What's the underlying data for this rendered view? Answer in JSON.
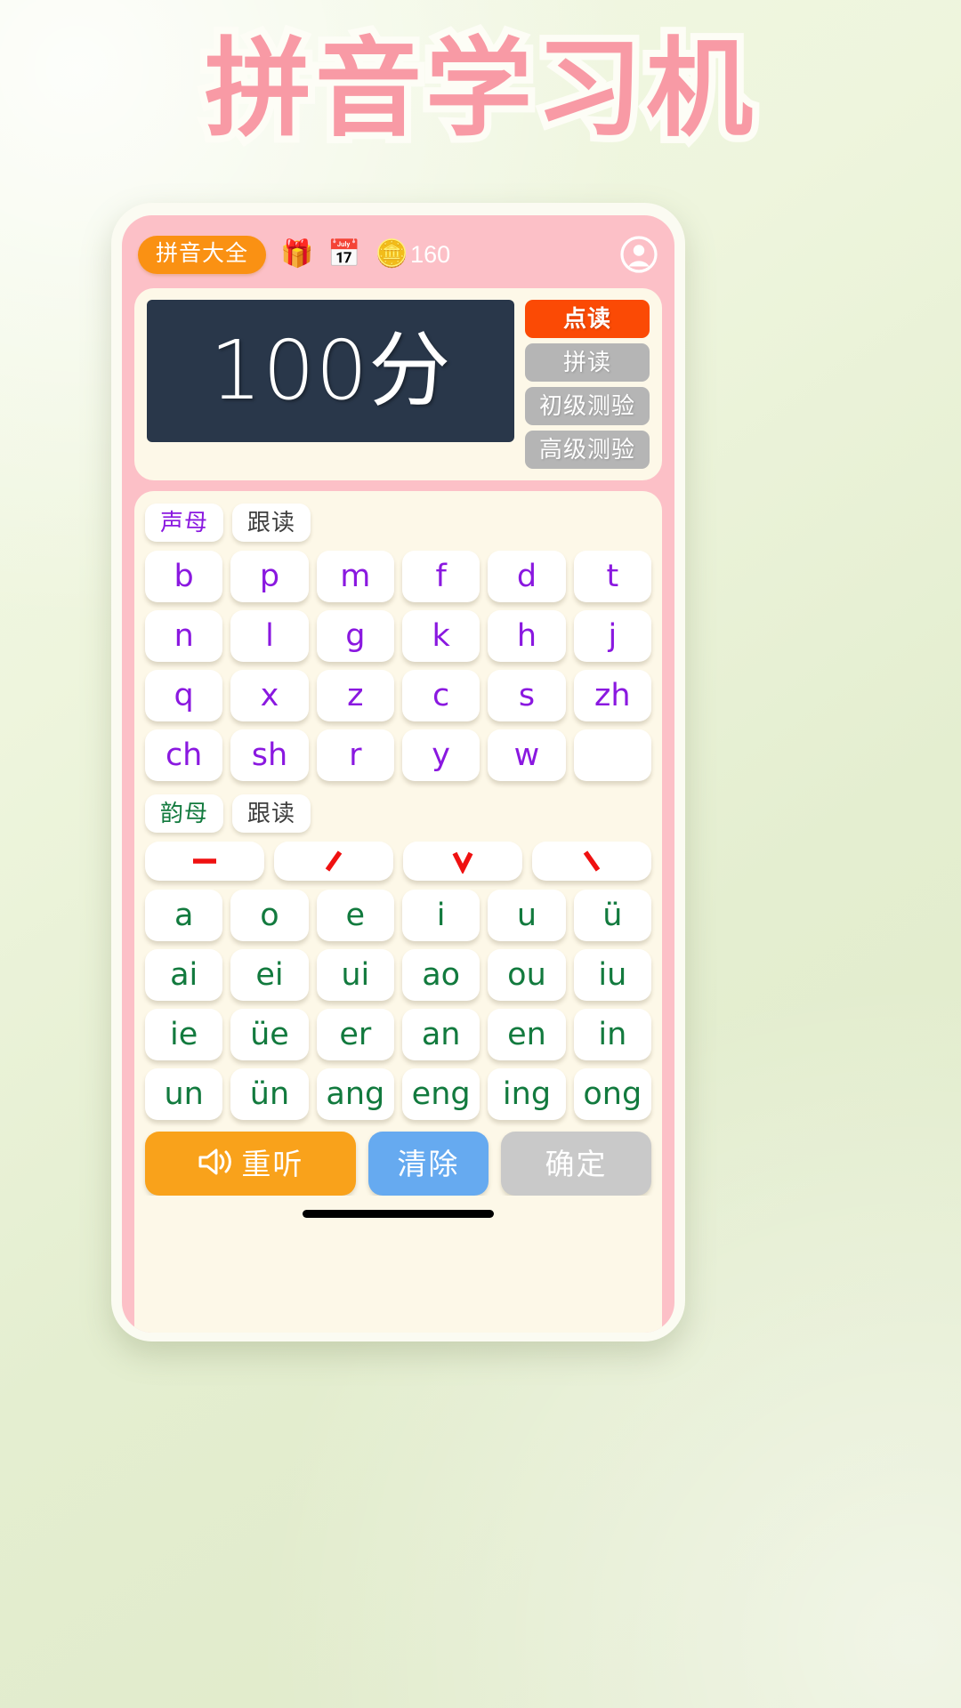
{
  "page": {
    "title": "拼音学习机",
    "title_color": "#f89aa5"
  },
  "header": {
    "all_pinyin_label": "拼音大全",
    "gift_icon": "🎁",
    "calendar_icon": "📅",
    "coins_icon": "🪙",
    "coin_count": "160",
    "avatar_icon": "user-circle"
  },
  "score_panel": {
    "display_value": "100分",
    "modes": [
      {
        "label": "点读",
        "active": true
      },
      {
        "label": "拼读",
        "active": false
      },
      {
        "label": "初级测验",
        "active": false
      },
      {
        "label": "高级测验",
        "active": false
      }
    ],
    "active_color": "#fb4a05",
    "inactive_color": "#b5b5b5",
    "display_bg": "#29374a"
  },
  "initials_section": {
    "section_label": "声母",
    "follow_label": "跟读",
    "label_color": "#8a18e0",
    "rows": [
      [
        "b",
        "p",
        "m",
        "f",
        "d",
        "t"
      ],
      [
        "n",
        "l",
        "g",
        "k",
        "h",
        "j"
      ],
      [
        "q",
        "x",
        "z",
        "c",
        "s",
        "zh"
      ],
      [
        "ch",
        "sh",
        "r",
        "y",
        "w",
        ""
      ]
    ]
  },
  "finals_section": {
    "section_label": "韵母",
    "follow_label": "跟读",
    "label_color": "#127a3e",
    "tones": [
      {
        "name": "tone-1-macron",
        "glyph": "ˉ"
      },
      {
        "name": "tone-2-acute",
        "glyph": "ˊ"
      },
      {
        "name": "tone-3-caron",
        "glyph": "ˇ"
      },
      {
        "name": "tone-4-grave",
        "glyph": "ˋ"
      }
    ],
    "tone_color": "#ef1111",
    "rows": [
      [
        "a",
        "o",
        "e",
        "i",
        "u",
        "ü"
      ],
      [
        "ai",
        "ei",
        "ui",
        "ao",
        "ou",
        "iu"
      ],
      [
        "ie",
        "üe",
        "er",
        "an",
        "en",
        "in"
      ],
      [
        "un",
        "ün",
        "ang",
        "eng",
        "ing",
        "ong"
      ]
    ]
  },
  "actions": {
    "replay_label": "重听",
    "replay_icon": "speaker-icon",
    "replay_color": "#f9a21b",
    "clear_label": "清除",
    "clear_color": "#66aaf0",
    "confirm_label": "确定",
    "confirm_color": "#c9c9c9"
  }
}
